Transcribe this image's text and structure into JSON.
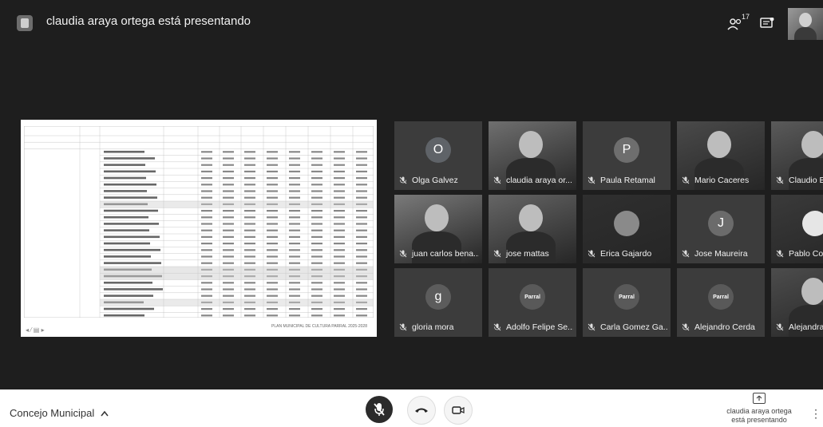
{
  "header": {
    "presenter_text": "claudia araya ortega está presentando",
    "participants_count": "17"
  },
  "presentation": {
    "caption": "PLAN MUNICIPAL DE CULTURA PARRAL 2025-2028",
    "toolbar": "◂ ⁄ ▤ ▸"
  },
  "tiles": [
    {
      "name": "Olga Galvez",
      "avatar": "O",
      "color": "#5f6368"
    },
    {
      "name": "claudia araya or...",
      "avatar": "",
      "color": ""
    },
    {
      "name": "Paula Retamal",
      "avatar": "P",
      "color": "#6e6e6e"
    },
    {
      "name": "Mario Caceres",
      "avatar": "",
      "color": ""
    },
    {
      "name": "Claudio Bravo",
      "avatar": "",
      "color": ""
    },
    {
      "name": "juan carlos bena...",
      "avatar": "",
      "color": ""
    },
    {
      "name": "jose mattas",
      "avatar": "",
      "color": ""
    },
    {
      "name": "Erica Gajardo",
      "avatar": "",
      "color": ""
    },
    {
      "name": "Jose Maureira",
      "avatar": "J",
      "color": "#6b6b6b"
    },
    {
      "name": "Pablo Contreras",
      "avatar": "",
      "color": ""
    },
    {
      "name": "gloria mora",
      "avatar": "g",
      "color": "#5c5c5c"
    },
    {
      "name": "Adolfo Felipe Se...",
      "avatar": "Parral",
      "color": "#595959"
    },
    {
      "name": "Carla Gomez Ga...",
      "avatar": "Parral",
      "color": "#595959"
    },
    {
      "name": "Alejandro Cerda",
      "avatar": "Parral",
      "color": "#595959"
    },
    {
      "name": "Alejandra Roman",
      "avatar": "",
      "color": ""
    }
  ],
  "bottombar": {
    "meeting_name": "Concejo Municipal",
    "present_label_1": "claudia araya ortega",
    "present_label_2": "está presentando"
  }
}
